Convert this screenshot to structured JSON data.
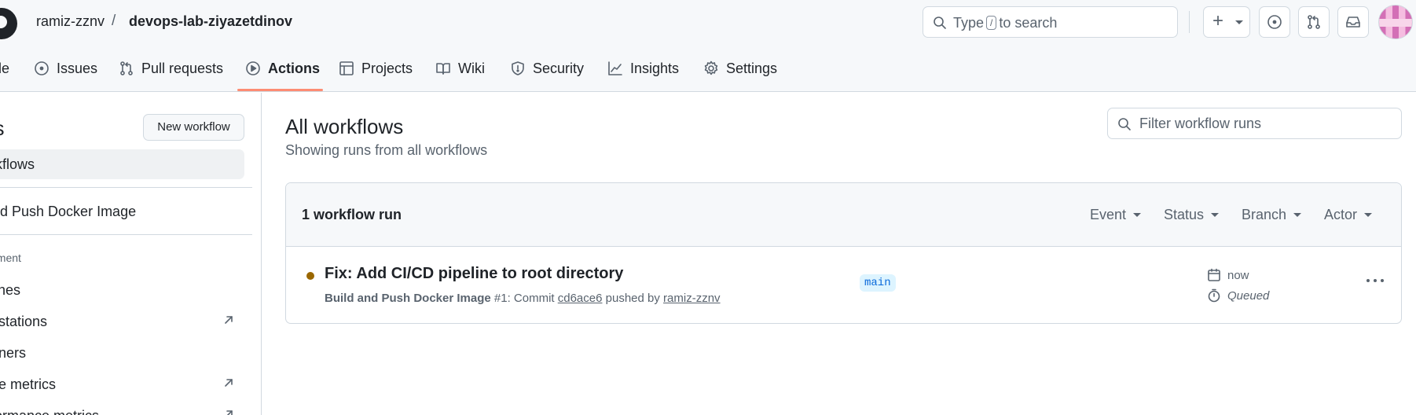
{
  "header": {
    "owner": "ramiz-zznv",
    "separator": "/",
    "repo": "devops-lab-ziyazetdinov",
    "search": {
      "prefix": "Type",
      "key": "/",
      "suffix": "to search"
    },
    "icons": [
      "github-logo-icon",
      "search-icon",
      "plus-icon",
      "issue-opened-icon",
      "git-pull-request-icon",
      "inbox-icon"
    ],
    "plus_label": "+"
  },
  "nav": {
    "tabs": [
      {
        "label": "de",
        "icon": "code-icon"
      },
      {
        "label": "Issues",
        "icon": "issue-opened-icon"
      },
      {
        "label": "Pull requests",
        "icon": "git-pull-request-icon"
      },
      {
        "label": "Actions",
        "icon": "play-icon",
        "selected": true
      },
      {
        "label": "Projects",
        "icon": "table-icon"
      },
      {
        "label": "Wiki",
        "icon": "book-icon"
      },
      {
        "label": "Security",
        "icon": "shield-icon"
      },
      {
        "label": "Insights",
        "icon": "graph-icon"
      },
      {
        "label": "Settings",
        "icon": "gear-icon"
      }
    ],
    "selected_underline_color": "#fd8c73"
  },
  "sidebar": {
    "title": "ns",
    "new_workflow_label": "New workflow",
    "all_workflows_label": "kflows",
    "workflow_item": "nd Push Docker Image",
    "section_label": "ement",
    "links": [
      "ches",
      "estations",
      "nners",
      "ge metrics",
      "formance metrics"
    ]
  },
  "main": {
    "title": "All workflows",
    "subtitle": "Showing runs from all workflows",
    "filter_placeholder": "Filter workflow runs",
    "runs_count": "1 workflow run",
    "filters": [
      "Event",
      "Status",
      "Branch",
      "Actor"
    ],
    "run": {
      "status_color": "#9a6700",
      "title": "Fix: Add CI/CD pipeline to root directory",
      "workflow_name": "Build and Push Docker Image",
      "run_number": "#1",
      "commit_text": ": Commit",
      "commit_sha": "cd6ace6",
      "pushed_by_text": "pushed by",
      "actor": "ramiz-zznv",
      "branch": "main",
      "time": "now",
      "status": "Queued"
    }
  }
}
